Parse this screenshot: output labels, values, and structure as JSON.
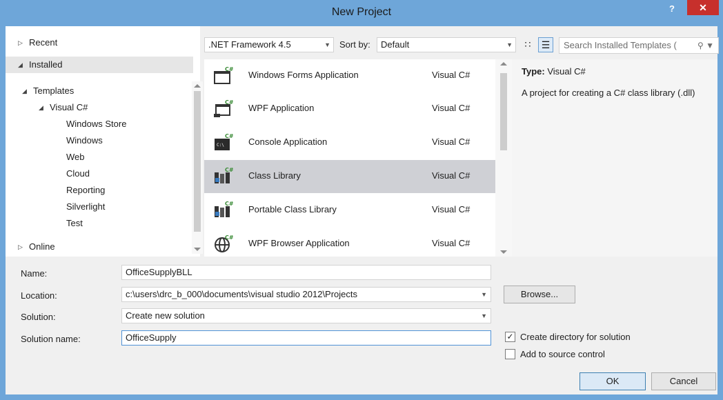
{
  "window": {
    "title": "New Project",
    "help": "?",
    "close": "✕"
  },
  "tree": {
    "recent": "Recent",
    "installed": "Installed",
    "templates": "Templates",
    "visual_csharp": "Visual C#",
    "children": [
      "Windows Store",
      "Windows",
      "Web",
      "Cloud",
      "Reporting",
      "Silverlight",
      "Test"
    ],
    "selected": "Windows",
    "online": "Online"
  },
  "toolbar": {
    "framework": ".NET Framework 4.5",
    "sort_label": "Sort by:",
    "sort_value": "Default",
    "search_placeholder": "Search Installed Templates (",
    "view_icons": [
      "grid-view-icon",
      "list-view-icon"
    ]
  },
  "templates": [
    {
      "name": "Windows Forms Application",
      "lang": "Visual C#",
      "icon": "windows-forms-icon"
    },
    {
      "name": "WPF Application",
      "lang": "Visual C#",
      "icon": "wpf-application-icon"
    },
    {
      "name": "Console Application",
      "lang": "Visual C#",
      "icon": "console-application-icon"
    },
    {
      "name": "Class Library",
      "lang": "Visual C#",
      "icon": "class-library-icon",
      "selected": true
    },
    {
      "name": "Portable Class Library",
      "lang": "Visual C#",
      "icon": "portable-class-library-icon"
    },
    {
      "name": "WPF Browser Application",
      "lang": "Visual C#",
      "icon": "wpf-browser-icon"
    }
  ],
  "description": {
    "type_label": "Type:",
    "type_value": "Visual C#",
    "text": "A project for creating a C# class library (.dll)"
  },
  "form": {
    "name_label": "Name:",
    "name_value": "OfficeSupplyBLL",
    "location_label": "Location:",
    "location_value": "c:\\users\\drc_b_000\\documents\\visual studio 2012\\Projects",
    "solution_label": "Solution:",
    "solution_value": "Create new solution",
    "solution_name_label": "Solution name:",
    "solution_name_value": "OfficeSupply",
    "browse": "Browse...",
    "create_dir_label": "Create directory for solution",
    "create_dir_checked": true,
    "source_control_label": "Add to source control",
    "source_control_checked": false,
    "ok": "OK",
    "cancel": "Cancel"
  },
  "colors": {
    "titlebar": "#6ea6d9",
    "close": "#c7302c",
    "selection": "#cfd0d5",
    "accent": "#4f92d6"
  }
}
